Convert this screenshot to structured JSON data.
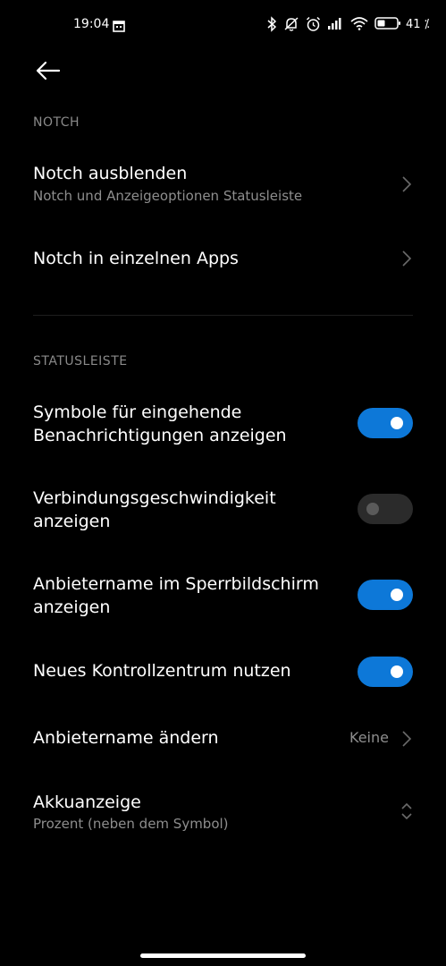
{
  "status_bar": {
    "time": "19:04",
    "battery_percent": 41,
    "battery_label": "41 ⁒",
    "icons": [
      "calendar-icon",
      "bluetooth-icon",
      "mute-icon",
      "alarm-icon",
      "signal-icon",
      "wifi-icon",
      "battery-icon"
    ]
  },
  "header": {
    "back_icon": "arrow-left-icon"
  },
  "sections": [
    {
      "header": "NOTCH",
      "items": [
        {
          "title": "Notch ausblenden",
          "subtitle": "Notch und Anzeigeoptionen Statusleiste",
          "control": "chevron"
        },
        {
          "title": "Notch in einzelnen Apps",
          "control": "chevron"
        }
      ]
    },
    {
      "header": "STATUSLEISTE",
      "items": [
        {
          "title_lines": [
            "Symbole für eingehende",
            "Benachrichtigungen anzeigen"
          ],
          "control": "toggle",
          "on": true
        },
        {
          "title_lines": [
            "Verbindungsgeschwindigkeit",
            "anzeigen"
          ],
          "control": "toggle",
          "on": false
        },
        {
          "title_lines": [
            "Anbietername im Sperrbildschirm",
            "anzeigen"
          ],
          "control": "toggle",
          "on": true
        },
        {
          "title": "Neues Kontrollzentrum nutzen",
          "control": "toggle",
          "on": true
        },
        {
          "title": "Anbietername ändern",
          "value": "Keine",
          "control": "chevron"
        },
        {
          "title": "Akkuanzeige",
          "subtitle": "Prozent (neben dem Symbol)",
          "control": "dropdown"
        }
      ]
    }
  ],
  "colors": {
    "background": "#000000",
    "accent": "#0d78d8",
    "secondary_text": "#8e8e8e"
  }
}
